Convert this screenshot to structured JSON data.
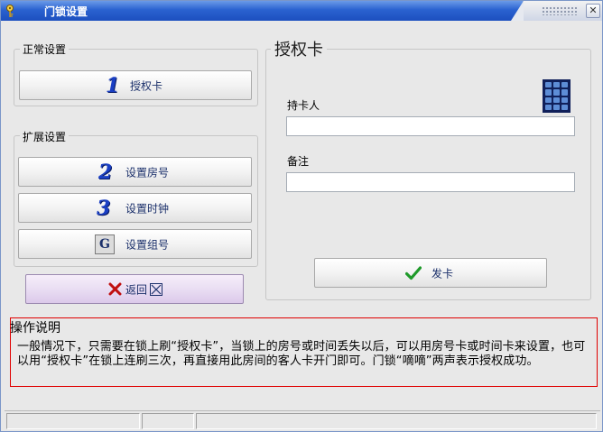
{
  "window": {
    "title": "门锁设置",
    "close_glyph": "✕"
  },
  "left": {
    "normal_group_label": "正常设置",
    "extended_group_label": "扩展设置",
    "buttons": {
      "auth_card": {
        "num": "1",
        "label": "授权卡"
      },
      "set_room": {
        "num": "2",
        "label": "设置房号"
      },
      "set_clock": {
        "num": "3",
        "label": "设置时钟"
      },
      "set_group": {
        "icon_letter": "G",
        "label": "设置组号"
      }
    },
    "back_button": {
      "label": "返回"
    }
  },
  "panel": {
    "title": "授权卡",
    "holder_label": "持卡人",
    "holder_value": "",
    "note_label": "备注",
    "note_value": "",
    "issue_button": {
      "label": "发卡"
    }
  },
  "help": {
    "title": "操作说明",
    "text": "一般情况下，只需要在锁上刷“授权卡”，当锁上的房号或时间丢失以后，可以用房号卡或时间卡来设置，也可以用“授权卡”在锁上连刷三次，再直接用此房间的客人卡开门即可。门锁“嘀嘀”两声表示授权成功。"
  },
  "colors": {
    "titlebar": "#2a62d0",
    "accent_num": "#1a3fc4",
    "help_border": "#e00000",
    "check_icon": "#1f9a2a",
    "back_x_icon": "#c01010"
  },
  "icons": {
    "app": "key-icon",
    "back": "x-mark-icon",
    "back_suffix": "boxed-x-icon",
    "issue": "checkmark-icon",
    "keypad": "keypad-icon"
  }
}
